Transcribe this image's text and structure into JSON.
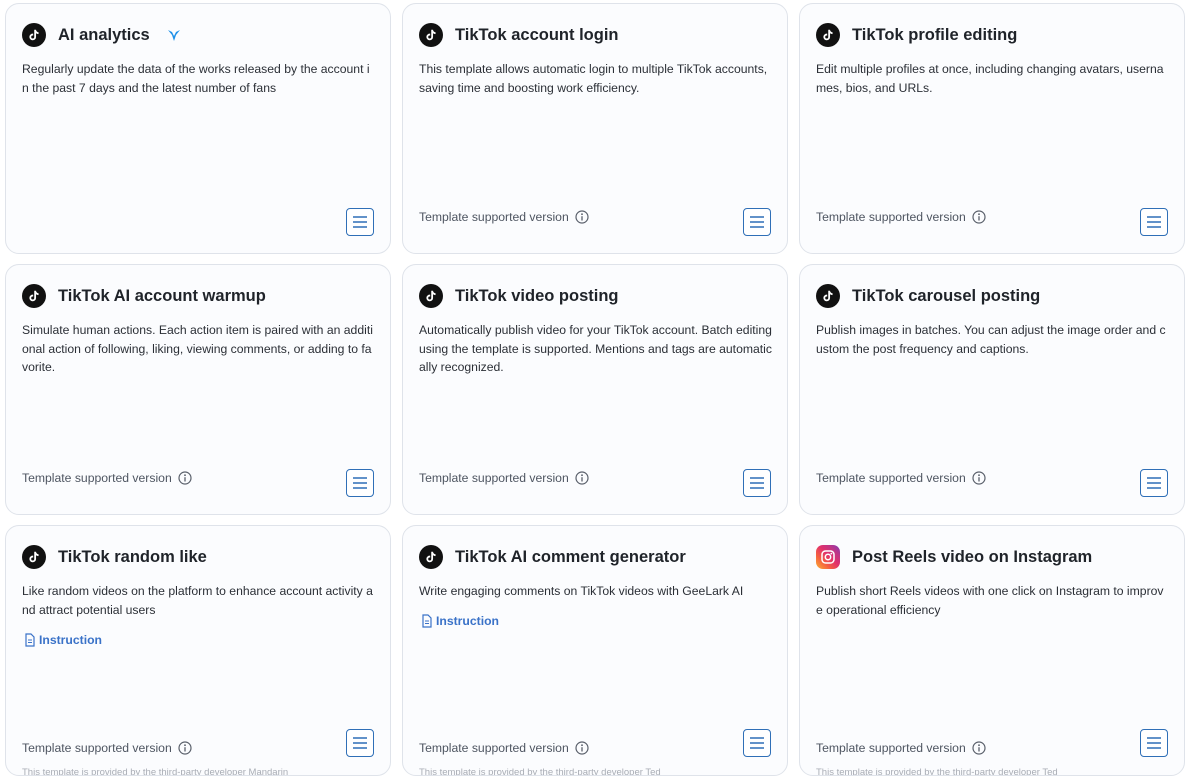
{
  "cards": [
    {
      "title": "AI analytics",
      "icon": "tiktok-icon",
      "verified": true,
      "description": "Regularly update the data of the works released by the account in the past 7 days and the latest number of fans"
    },
    {
      "title": "TikTok account login",
      "icon": "tiktok-icon",
      "description": "This template allows automatic login to multiple TikTok accounts, saving time and boosting work efficiency.",
      "support_label": "Template supported version"
    },
    {
      "title": "TikTok profile editing",
      "icon": "tiktok-icon",
      "description": "Edit multiple profiles at once, including changing avatars, usernames, bios, and URLs.",
      "support_label": "Template supported version"
    },
    {
      "title": "TikTok AI account warmup",
      "icon": "tiktok-icon",
      "description": "Simulate human actions. Each action item is paired with an additional action of following, liking, viewing comments, or adding to favorite.",
      "support_label": "Template supported version"
    },
    {
      "title": "TikTok video posting",
      "icon": "tiktok-icon",
      "description": "Automatically publish video for your TikTok account. Batch editing using the template is supported. Mentions and tags are automatically recognized.",
      "support_label": "Template supported version"
    },
    {
      "title": "TikTok carousel posting",
      "icon": "tiktok-icon",
      "description": "Publish images in batches. You can adjust the image order and custom the post frequency and captions.",
      "support_label": "Template supported version"
    },
    {
      "title": "TikTok random like",
      "icon": "tiktok-icon",
      "description": "Like random videos on the platform to enhance account activity and attract potential users",
      "instruction": "Instruction",
      "support_label": "Template supported version",
      "provider": "This template is provided by the third-party developer Mandarin"
    },
    {
      "title": "TikTok AI comment generator",
      "icon": "tiktok-icon",
      "description": "Write engaging comments on TikTok videos with GeeLark AI",
      "instruction": "Instruction",
      "support_label": "Template supported version",
      "provider": "This template is provided by the third-party developer Ted"
    },
    {
      "title": "Post Reels video on Instagram",
      "icon": "instagram-icon",
      "description": "Publish short Reels videos with one click on Instagram to improve operational efficiency",
      "support_label": "Template supported version",
      "provider": "This template is provided by the third-party developer Ted"
    }
  ],
  "colors": {
    "accent": "#2f6fb7",
    "link": "#3a72c8",
    "card_bg": "#fbfcfe",
    "card_border": "#dfe3ea"
  }
}
